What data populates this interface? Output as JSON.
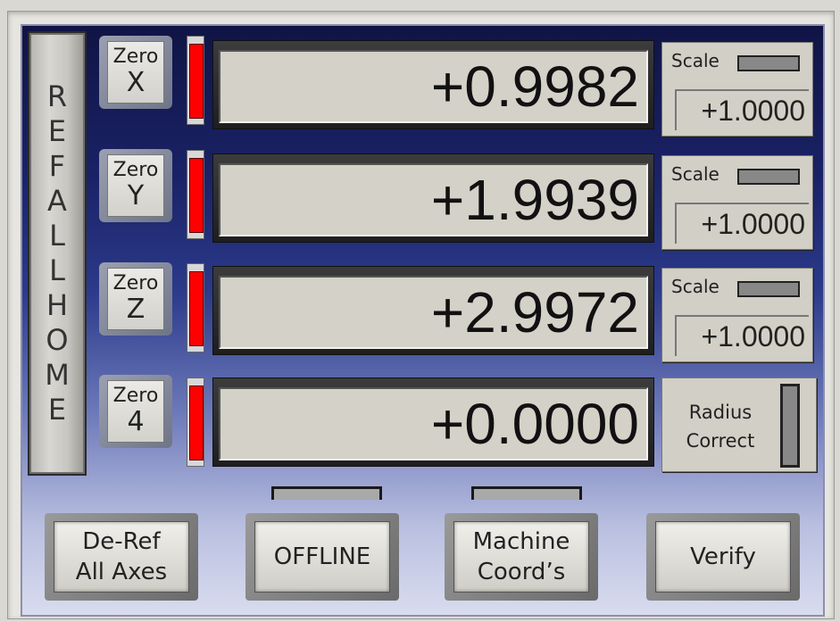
{
  "ref_all_home": "REF ALL HOME",
  "axes": [
    {
      "zero_label": "Zero",
      "axis": "X",
      "value": "+0.9982",
      "scale_label": "Scale",
      "scale_value": "+1.0000"
    },
    {
      "zero_label": "Zero",
      "axis": "Y",
      "value": "+1.9939",
      "scale_label": "Scale",
      "scale_value": "+1.0000"
    },
    {
      "zero_label": "Zero",
      "axis": "Z",
      "value": "+2.9972",
      "scale_label": "Scale",
      "scale_value": "+1.0000"
    },
    {
      "zero_label": "Zero",
      "axis": "4",
      "value": "+0.0000"
    }
  ],
  "radius_correct": {
    "line1": "Radius",
    "line2": "Correct"
  },
  "buttons": {
    "deref_line1": "De-Ref",
    "deref_line2": "All Axes",
    "offline": "OFFLINE",
    "machine_line1": "Machine",
    "machine_line2": "Coord’s",
    "verify": "Verify"
  },
  "colors": {
    "led_red": "#ff0000",
    "panel_top": "#101445",
    "panel_bottom": "#d9dcef"
  }
}
